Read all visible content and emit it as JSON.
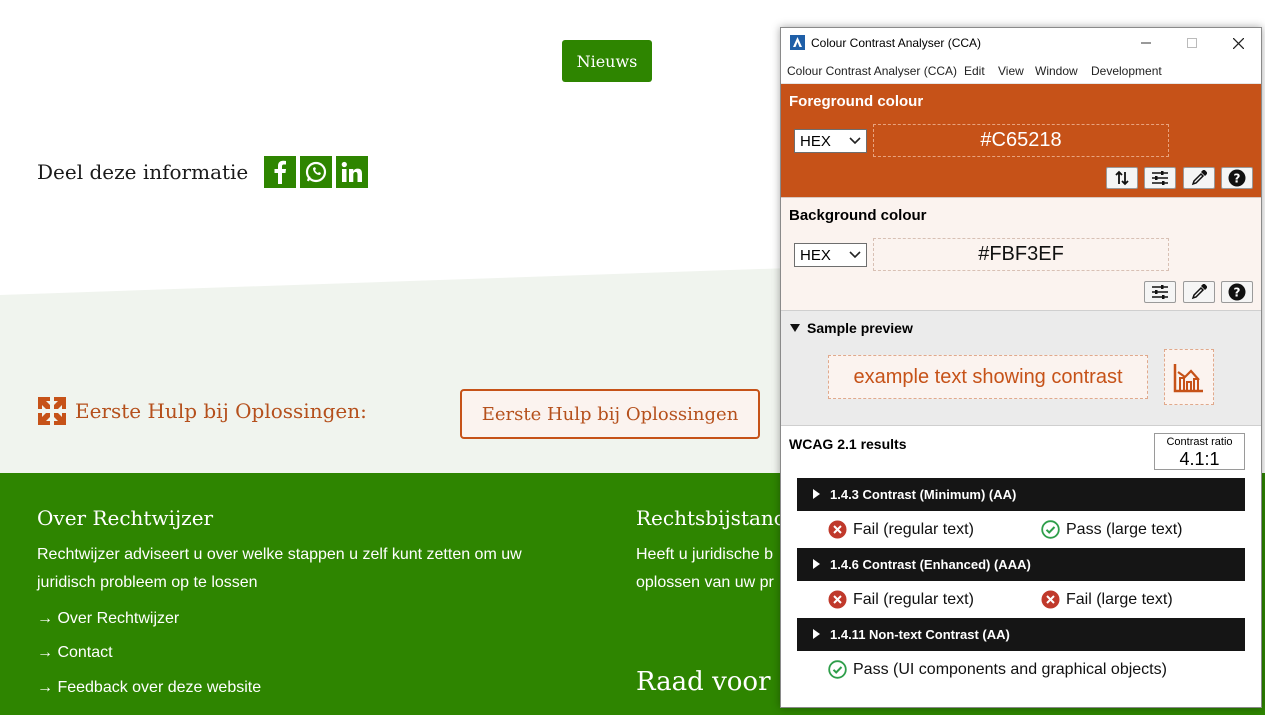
{
  "site": {
    "nieuws_button": "Nieuws",
    "share_label": "Deel deze informatie",
    "social_icons": [
      "facebook-icon",
      "whatsapp-icon",
      "linkedin-icon"
    ],
    "first_aid_label": "Eerste Hulp bij Oplossingen:",
    "first_aid_button": "Eerste Hulp bij Oplossingen",
    "footer": {
      "col1_title": "Over Rechtwijzer",
      "col1_text": "Rechtwijzer adviseert u over welke stappen u zelf kunt zetten om uw juridisch probleem op te lossen",
      "links": [
        "→ Over Rechtwijzer",
        "→ Contact",
        "→ Feedback over deze website"
      ],
      "col2_title": "Rechtsbijstand",
      "col2_text_line1": "Heeft u juridische b",
      "col2_text_line2": "oplossen van uw pr",
      "raad_text": "Raad voor R"
    },
    "colors": {
      "green": "#2e8500",
      "orange": "#c65218",
      "band": "#f0f4ee"
    }
  },
  "cca": {
    "title": "Colour Contrast Analyser (CCA)",
    "menu": [
      "Colour Contrast Analyser (CCA)",
      "Edit",
      "View",
      "Window",
      "Development"
    ],
    "foreground": {
      "title": "Foreground colour",
      "format": "HEX",
      "value": "#C65218",
      "color": "#C65218"
    },
    "background": {
      "title": "Background colour",
      "format": "HEX",
      "value": "#FBF3EF",
      "color": "#FBF3EF"
    },
    "preview": {
      "title": "Sample preview",
      "sample_text": "example text showing contrast"
    },
    "results": {
      "title": "WCAG 2.1 results",
      "ratio_label": "Contrast ratio",
      "ratio_value": "4.1:1",
      "criteria": [
        {
          "label": "1.4.3 Contrast (Minimum) (AA)",
          "results": [
            {
              "status": "fail",
              "text": "Fail (regular text)"
            },
            {
              "status": "pass",
              "text": "Pass (large text)"
            }
          ]
        },
        {
          "label": "1.4.6 Contrast (Enhanced) (AAA)",
          "results": [
            {
              "status": "fail",
              "text": "Fail (regular text)"
            },
            {
              "status": "fail",
              "text": "Fail (large text)"
            }
          ]
        },
        {
          "label": "1.4.11 Non-text Contrast (AA)",
          "results": [
            {
              "status": "pass",
              "text": "Pass (UI components and graphical objects)"
            }
          ]
        }
      ]
    }
  }
}
